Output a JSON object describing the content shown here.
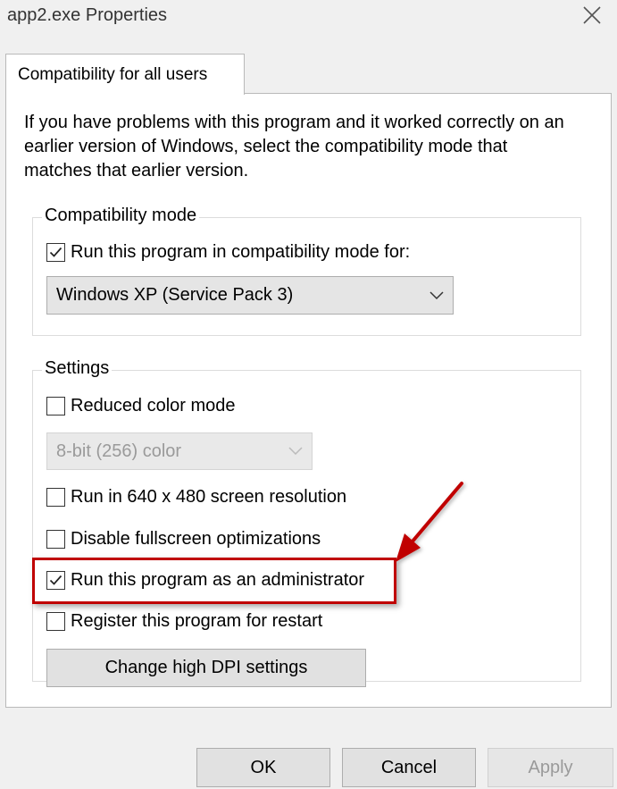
{
  "window": {
    "title": "app2.exe Properties"
  },
  "tab": {
    "label": "Compatibility for all users"
  },
  "description": "If you have problems with this program and it worked correctly on an earlier version of Windows, select the compatibility mode that matches that earlier version.",
  "compatibility_mode": {
    "legend": "Compatibility mode",
    "checkbox_label": "Run this program in compatibility mode for:",
    "checked": true,
    "selected_os": "Windows XP (Service Pack 3)"
  },
  "settings": {
    "legend": "Settings",
    "reduced_color": {
      "label": "Reduced color mode",
      "checked": false
    },
    "color_select": "8-bit (256) color",
    "res640": {
      "label": "Run in 640 x 480 screen resolution",
      "checked": false
    },
    "fullscreen": {
      "label": "Disable fullscreen optimizations",
      "checked": false
    },
    "admin": {
      "label": "Run this program as an administrator",
      "checked": true
    },
    "restart": {
      "label": "Register this program for restart",
      "checked": false
    },
    "dpi_button": "Change high DPI settings"
  },
  "buttons": {
    "ok": "OK",
    "cancel": "Cancel",
    "apply": "Apply"
  },
  "colors": {
    "highlight": "#c00000",
    "arrow": "#c00000"
  }
}
